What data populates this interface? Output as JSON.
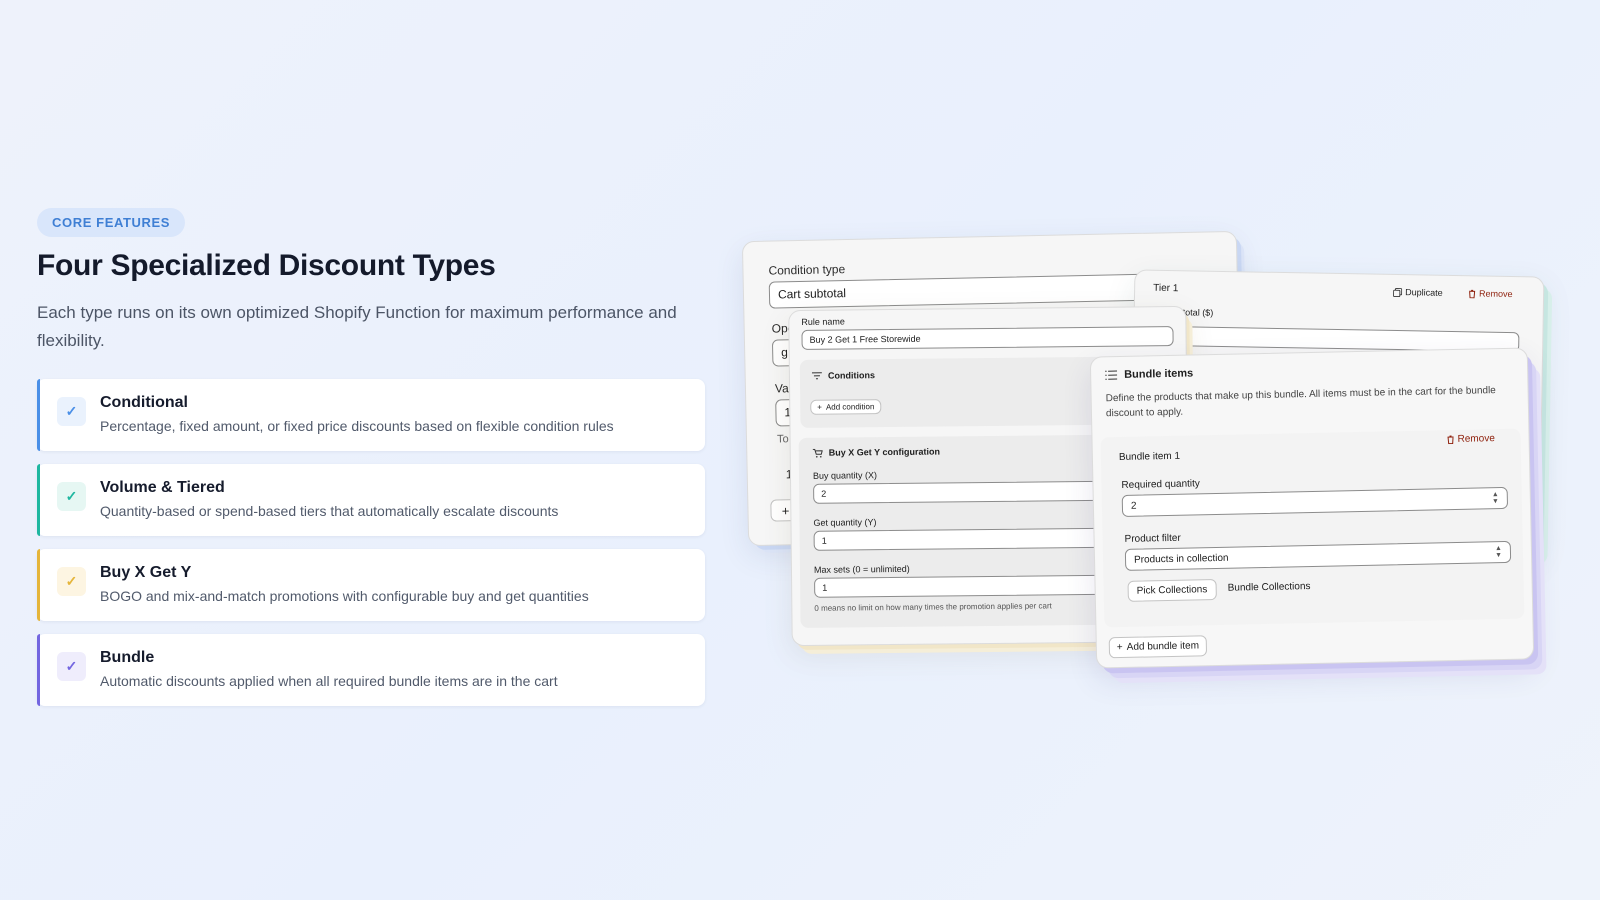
{
  "hero": {
    "badge": "CORE FEATURES",
    "title": "Four Specialized Discount Types",
    "subtitle": "Each type runs on its own optimized Shopify Function for maximum performance and flexibility."
  },
  "features": [
    {
      "title": "Conditional",
      "desc": "Percentage, fixed amount, or fixed price discounts based on flexible condition rules",
      "accent": "#4a8fe7",
      "check_bg": "#eaf2fd",
      "check_color": "#4a8fe7"
    },
    {
      "title": "Volume & Tiered",
      "desc": "Quantity-based or spend-based tiers that automatically escalate discounts",
      "accent": "#1fb7a0",
      "check_bg": "#e6f7f3",
      "check_color": "#1fb7a0"
    },
    {
      "title": "Buy X Get Y",
      "desc": "BOGO and mix-and-match promotions with configurable buy and get quantities",
      "accent": "#e5b53a",
      "check_bg": "#fdf5e2",
      "check_color": "#e5b53a"
    },
    {
      "title": "Bundle",
      "desc": "Automatic discounts applied when all required bundle items are in the cart",
      "accent": "#7366e0",
      "check_bg": "#efedfc",
      "check_color": "#7366e0"
    }
  ],
  "check_glyph": "✓",
  "conditional_card": {
    "condition_type_label": "Condition type",
    "condition_type_value": "Cart subtotal",
    "operator_label": "Ope",
    "operator_value": "g",
    "value_label": "Val",
    "value_value": "1",
    "tooltip_fragment": "To",
    "row_fragment": "1",
    "plus": "+"
  },
  "tier_card": {
    "title": "Tier 1",
    "duplicate": "Duplicate",
    "remove": "Remove",
    "field_label": "total ($)"
  },
  "bxgy_card": {
    "rule_name_label": "Rule name",
    "rule_name_value": "Buy 2 Get 1 Free Storewide",
    "conditions_title": "Conditions",
    "add_condition": "Add condition",
    "config_title": "Buy X Get Y configuration",
    "buy_label": "Buy quantity (X)",
    "buy_value": "2",
    "get_label": "Get quantity (Y)",
    "get_value": "1",
    "max_label": "Max sets (0 = unlimited)",
    "max_value": "1",
    "max_help": "0 means no limit on how many times the promotion applies per cart"
  },
  "bundle_card": {
    "title": "Bundle items",
    "description": "Define the products that make up this bundle. All items must be in the cart for the bundle discount to apply.",
    "item_title": "Bundle item 1",
    "remove": "Remove",
    "required_qty_label": "Required quantity",
    "required_qty_value": "2",
    "filter_label": "Product filter",
    "filter_value": "Products in collection",
    "pick_collections": "Pick Collections",
    "collections_value": "Bundle Collections",
    "add_bundle_item": "Add bundle item"
  }
}
